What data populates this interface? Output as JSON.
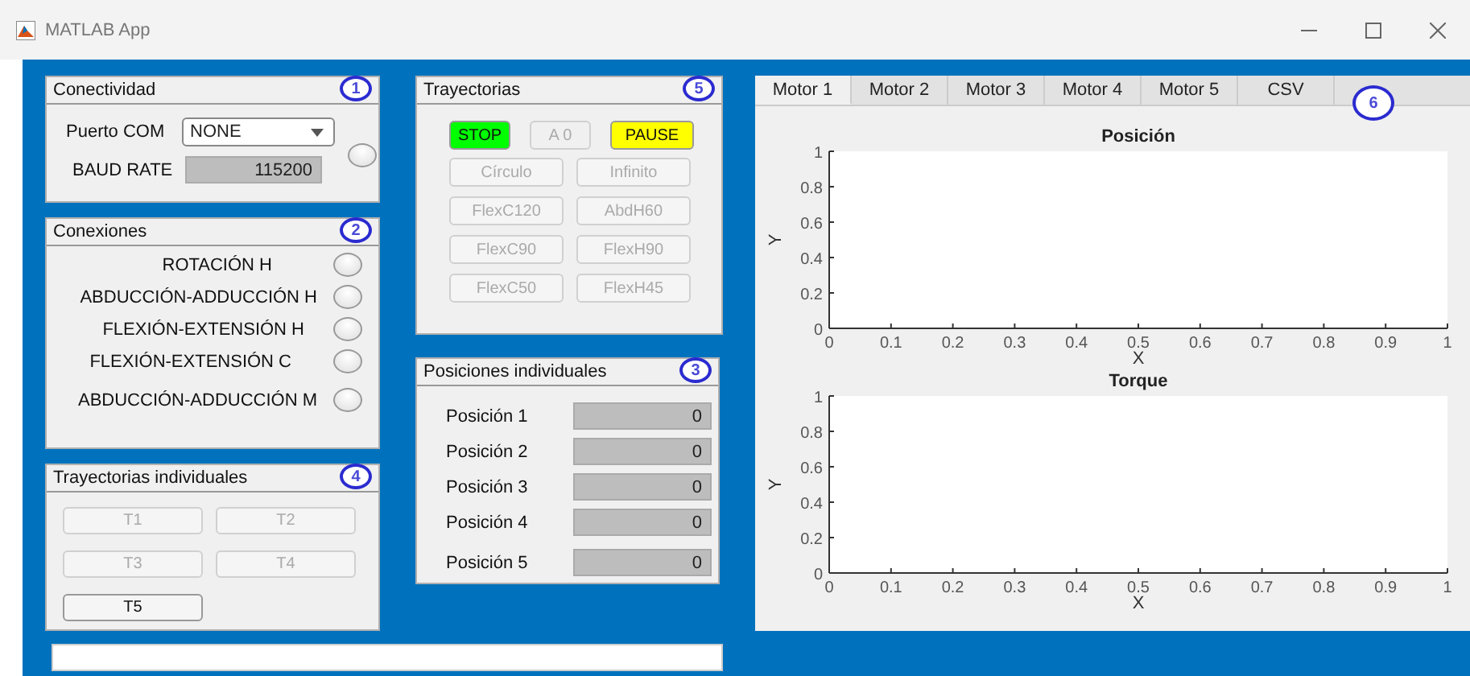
{
  "window": {
    "title": "MATLAB App"
  },
  "conectividad": {
    "title": "Conectividad",
    "marker": "1",
    "port_label": "Puerto COM",
    "port_value": "NONE",
    "baud_label": "BAUD RATE",
    "baud_value": "115200",
    "lamp_on": false
  },
  "conexiones": {
    "title": "Conexiones",
    "marker": "2",
    "items": [
      {
        "label": "ROTACIÓN H",
        "on": false
      },
      {
        "label": "ABDUCCIÓN-ADDUCCIÓN H",
        "on": false
      },
      {
        "label": "FLEXIÓN-EXTENSIÓN H",
        "on": false
      },
      {
        "label": "FLEXIÓN-EXTENSIÓN C",
        "on": false
      },
      {
        "label": "ABDUCCIÓN-ADDUCCIÓN M",
        "on": false
      }
    ]
  },
  "trayectorias_individuales": {
    "title": "Trayectorias individuales",
    "marker": "4",
    "buttons": [
      {
        "label": "T1",
        "disabled": true
      },
      {
        "label": "T2",
        "disabled": true
      },
      {
        "label": "T3",
        "disabled": true
      },
      {
        "label": "T4",
        "disabled": true
      },
      {
        "label": "T5",
        "disabled": false
      }
    ]
  },
  "trayectorias": {
    "title": "Trayectorias",
    "marker": "5",
    "top_buttons": [
      {
        "label": "STOP",
        "disabled": false,
        "color": "#00ff00"
      },
      {
        "label": "A 0",
        "disabled": true,
        "color": "#f0f0f0"
      },
      {
        "label": "PAUSE",
        "disabled": false,
        "color": "#ffff00"
      }
    ],
    "buttons": [
      {
        "label": "Círculo",
        "disabled": true
      },
      {
        "label": "Infinito",
        "disabled": true
      },
      {
        "label": "FlexC120",
        "disabled": true
      },
      {
        "label": "AbdH60",
        "disabled": true
      },
      {
        "label": "FlexC90",
        "disabled": true
      },
      {
        "label": "FlexH90",
        "disabled": true
      },
      {
        "label": "FlexC50",
        "disabled": true
      },
      {
        "label": "FlexH45",
        "disabled": true
      }
    ]
  },
  "posiciones": {
    "title": "Posiciones individuales",
    "marker": "3",
    "items": [
      {
        "label": "Posición 1",
        "value": "0"
      },
      {
        "label": "Posición 2",
        "value": "0"
      },
      {
        "label": "Posición 3",
        "value": "0"
      },
      {
        "label": "Posición 4",
        "value": "0"
      },
      {
        "label": "Posición 5",
        "value": "0"
      }
    ]
  },
  "tabs": [
    {
      "label": "Motor 1",
      "selected": true
    },
    {
      "label": "Motor 2",
      "selected": false
    },
    {
      "label": "Motor 3",
      "selected": false
    },
    {
      "label": "Motor 4",
      "selected": false
    },
    {
      "label": "Motor 5",
      "selected": false
    },
    {
      "label": "CSV",
      "selected": false
    }
  ],
  "tab_marker": "6",
  "charts": [
    {
      "chart_data": {
        "type": "line",
        "title": "Posición",
        "xlabel": "X",
        "ylabel": "Y",
        "xlim": [
          0,
          1
        ],
        "ylim": [
          0,
          1
        ],
        "xticks": [
          0,
          0.1,
          0.2,
          0.3,
          0.4,
          0.5,
          0.6,
          0.7,
          0.8,
          0.9,
          1
        ],
        "yticks": [
          0,
          0.2,
          0.4,
          0.6,
          0.8,
          1
        ]
      }
    },
    {
      "chart_data": {
        "type": "line",
        "title": "Torque",
        "xlabel": "X",
        "ylabel": "Y",
        "xlim": [
          0,
          1
        ],
        "ylim": [
          0,
          1
        ],
        "xticks": [
          0,
          0.1,
          0.2,
          0.3,
          0.4,
          0.5,
          0.6,
          0.7,
          0.8,
          0.9,
          1
        ],
        "yticks": [
          0,
          0.2,
          0.4,
          0.6,
          0.8,
          1
        ]
      }
    }
  ]
}
